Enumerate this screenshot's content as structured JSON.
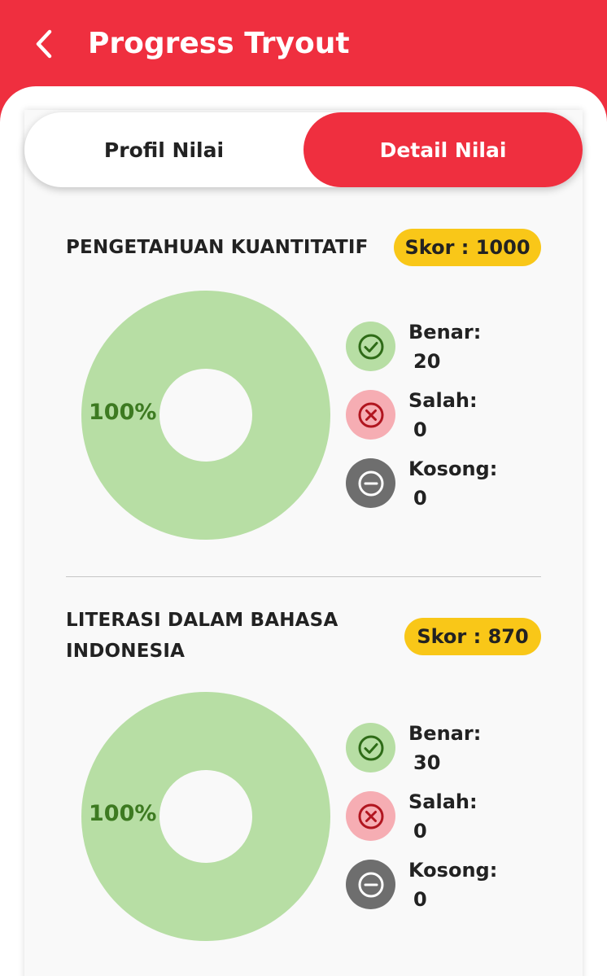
{
  "header": {
    "title": "Progress Tryout"
  },
  "tabs": [
    {
      "label": "Profil Nilai",
      "active": false
    },
    {
      "label": "Detail Nilai",
      "active": true
    }
  ],
  "colors": {
    "primary": "#ef2f3f",
    "score_badge": "#f9c718",
    "benar": "#b7dea4",
    "salah": "#f6adb3",
    "kosong": "#6e6e6e",
    "donut": "#b7dea4",
    "percent_text": "#3d7a21"
  },
  "subjects": [
    {
      "title_lines": [
        "PENGETAHUAN KUANTITATIF"
      ],
      "score_label": "Skor : 1000",
      "percent_label": "100%",
      "legend": [
        {
          "label": "Benar:",
          "value": "20",
          "icon": "check-circle-icon"
        },
        {
          "label": "Salah:",
          "value": "0",
          "icon": "x-circle-icon"
        },
        {
          "label": "Kosong:",
          "value": "0",
          "icon": "minus-circle-icon"
        }
      ]
    },
    {
      "title_lines": [
        "LITERASI DALAM BAHASA",
        "INDONESIA"
      ],
      "score_label": "Skor : 870",
      "percent_label": "100%",
      "legend": [
        {
          "label": "Benar:",
          "value": "30",
          "icon": "check-circle-icon"
        },
        {
          "label": "Salah:",
          "value": "0",
          "icon": "x-circle-icon"
        },
        {
          "label": "Kosong:",
          "value": "0",
          "icon": "minus-circle-icon"
        }
      ]
    }
  ]
}
